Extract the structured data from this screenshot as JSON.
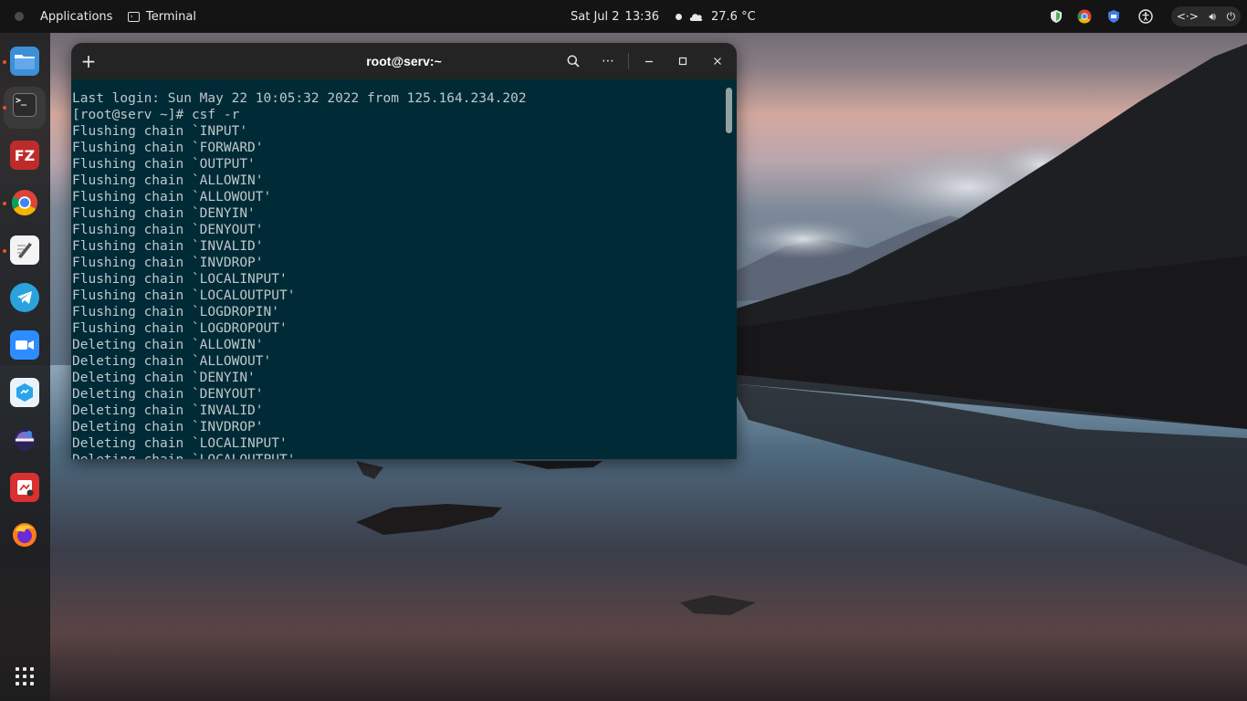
{
  "topbar": {
    "applications_label": "Applications",
    "terminal_label": "Terminal",
    "date": "Sat Jul 2",
    "time": "13:36",
    "weather": "27.6 °C"
  },
  "dock": {
    "items": [
      {
        "name": "files",
        "running": true
      },
      {
        "name": "terminal",
        "running": true,
        "glyph": ">_"
      },
      {
        "name": "filezilla",
        "running": false,
        "glyph": "FZ"
      },
      {
        "name": "chrome",
        "running": true
      },
      {
        "name": "text-editor",
        "running": true
      },
      {
        "name": "telegram",
        "running": false
      },
      {
        "name": "zoom",
        "running": false
      },
      {
        "name": "vpn",
        "running": false
      },
      {
        "name": "eclipse",
        "running": false
      },
      {
        "name": "screenshot",
        "running": false
      },
      {
        "name": "firefox",
        "running": false
      }
    ]
  },
  "terminal": {
    "title": "root@serv:~",
    "lines": [
      "",
      "Last login: Sun May 22 10:05:32 2022 from 125.164.234.202",
      "[root@serv ~]# csf -r",
      "Flushing chain `INPUT'",
      "Flushing chain `FORWARD'",
      "Flushing chain `OUTPUT'",
      "Flushing chain `ALLOWIN'",
      "Flushing chain `ALLOWOUT'",
      "Flushing chain `DENYIN'",
      "Flushing chain `DENYOUT'",
      "Flushing chain `INVALID'",
      "Flushing chain `INVDROP'",
      "Flushing chain `LOCALINPUT'",
      "Flushing chain `LOCALOUTPUT'",
      "Flushing chain `LOGDROPIN'",
      "Flushing chain `LOGDROPOUT'",
      "Deleting chain `ALLOWIN'",
      "Deleting chain `ALLOWOUT'",
      "Deleting chain `DENYIN'",
      "Deleting chain `DENYOUT'",
      "Deleting chain `INVALID'",
      "Deleting chain `INVDROP'",
      "Deleting chain `LOCALINPUT'",
      "Deleting chain `LOCALOUTPUT'"
    ]
  },
  "colors": {
    "terminal_bg": "#002b36",
    "terminal_fg": "#bfc7cd",
    "accent": "#e95420"
  }
}
